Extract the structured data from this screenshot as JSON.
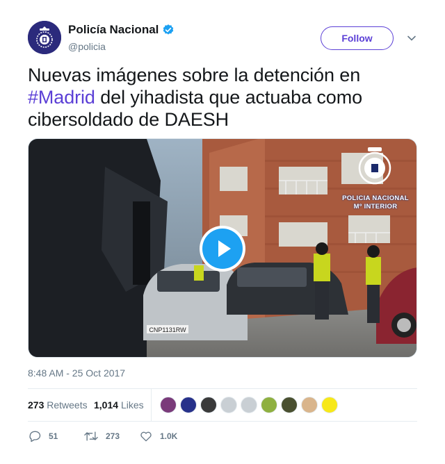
{
  "author": {
    "name": "Policía Nacional",
    "handle": "@policia",
    "verified": true,
    "avatar_color": "#2b2a7c"
  },
  "follow_button": {
    "label": "Follow",
    "color": "#5b3fd6"
  },
  "tweet": {
    "text_before": "Nuevas imágenes sobre la detención en ",
    "hashtag": "#Madrid",
    "text_after": " del yihadista que actuaba como cibersoldado de DAESH"
  },
  "media": {
    "type": "video",
    "watermark_line1": "POLICIA NACIONAL",
    "watermark_line2": "Mº INTERIOR",
    "plate": "CNP1131RW",
    "play_color": "#1da1f2"
  },
  "timestamp": "8:48 AM - 25 Oct 2017",
  "stats": {
    "retweets_count": "273",
    "retweets_label": "Retweets",
    "likes_count": "1,014",
    "likes_label": "Likes"
  },
  "likers": [
    "#7a3b7a",
    "#27318a",
    "#3a3a3a",
    "#c9cfd4",
    "#c9cfd4",
    "#8fb040",
    "#4a5030",
    "#d9b58c",
    "#f7e81a"
  ],
  "actions": {
    "replies": "51",
    "retweets": "273",
    "likes": "1.0K"
  }
}
